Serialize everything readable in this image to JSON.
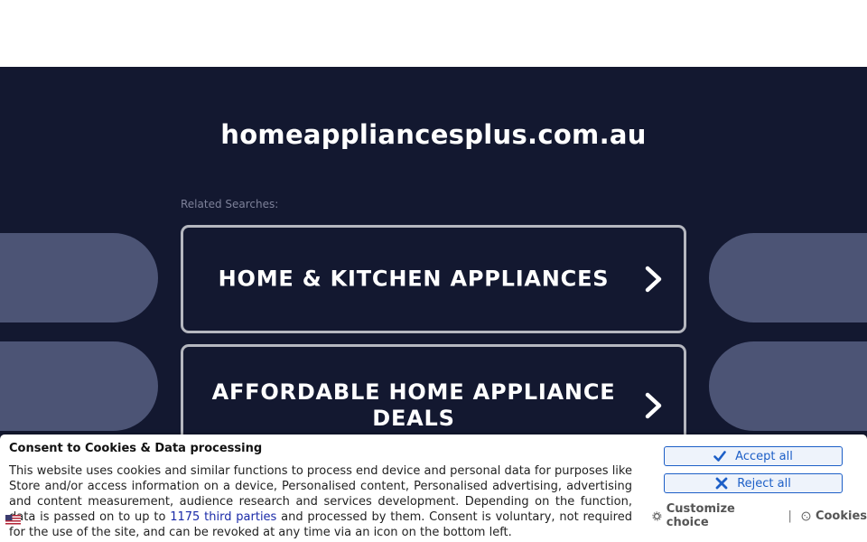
{
  "page": {
    "domain": "homeappliancesplus.com.au",
    "related_label": "Related Searches:"
  },
  "searches": [
    {
      "label": "HOME & KITCHEN APPLIANCES"
    },
    {
      "label": "AFFORDABLE HOME APPLIANCE DEALS"
    }
  ],
  "consent": {
    "title": "Consent to Cookies & Data processing",
    "text_before": "This website uses cookies and similar functions to process end device and personal data for purposes like Store and/or access information on a device, Personalised content, Personalised advertising, advertising and content measurement, audience research and services development. Depending on the function, data is passed on to up to ",
    "link_text": "1175 third parties",
    "text_after": " and processed by them. Consent is voluntary, not required for the use of the site, and can be revoked at any time via an icon on the bottom left.",
    "accept_label": "Accept all",
    "reject_label": "Reject all",
    "customize_label": "Customize choice",
    "separator": "|",
    "cookies_label": "Cookies"
  },
  "colors": {
    "background": "#131830",
    "pill": "#4c5475",
    "button_border": "#b5b7bf",
    "consent_accent": "#1d5fc7",
    "link": "#1a2aa8"
  },
  "icons": [
    "chevron-right-icon",
    "check-icon",
    "x-icon",
    "gear-icon",
    "cookie-icon",
    "language-flag-icon"
  ]
}
